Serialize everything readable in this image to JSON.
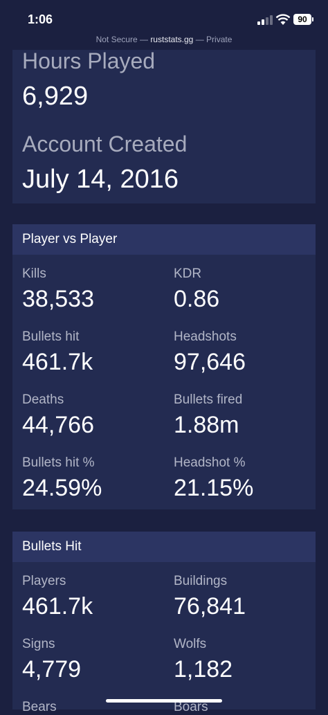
{
  "status_bar": {
    "time": "1:06",
    "battery": "90"
  },
  "browser": {
    "not_secure": "Not Secure",
    "separator": "—",
    "host": "ruststats.gg",
    "mode": "Private"
  },
  "profile": {
    "hours_label": "Hours Played",
    "hours_value": "6,929",
    "created_label": "Account Created",
    "created_value": "July 14, 2016"
  },
  "pvp": {
    "title": "Player vs Player",
    "stats": [
      {
        "label": "Kills",
        "value": "38,533"
      },
      {
        "label": "KDR",
        "value": "0.86"
      },
      {
        "label": "Bullets hit",
        "value": "461.7k"
      },
      {
        "label": "Headshots",
        "value": "97,646"
      },
      {
        "label": "Deaths",
        "value": "44,766"
      },
      {
        "label": "Bullets fired",
        "value": "1.88m"
      },
      {
        "label": "Bullets hit %",
        "value": "24.59%"
      },
      {
        "label": "Headshot %",
        "value": "21.15%"
      }
    ]
  },
  "bullets_hit": {
    "title": "Bullets Hit",
    "stats": [
      {
        "label": "Players",
        "value": "461.7k"
      },
      {
        "label": "Buildings",
        "value": "76,841"
      },
      {
        "label": "Signs",
        "value": "4,779"
      },
      {
        "label": "Wolfs",
        "value": "1,182"
      },
      {
        "label": "Bears",
        "value": ""
      },
      {
        "label": "Boars",
        "value": ""
      }
    ]
  }
}
